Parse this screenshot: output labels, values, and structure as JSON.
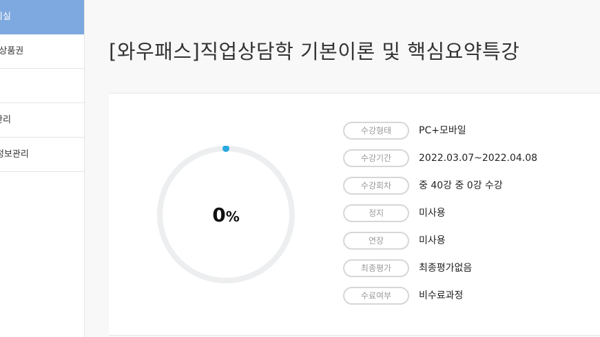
{
  "sidebar": {
    "items": [
      {
        "label": "의실",
        "active": true
      },
      {
        "label": "/상품권",
        "active": false
      },
      {
        "label": "",
        "active": false
      },
      {
        "label": "관리",
        "active": false
      },
      {
        "label": "정보관리",
        "active": false
      }
    ]
  },
  "course": {
    "title": "[와우패스]직업상담학 기본이론 및 핵심요약특강"
  },
  "progress": {
    "value": 0,
    "number": "0",
    "sign": "%"
  },
  "info": [
    {
      "label": "수강형태",
      "value": "PC+모바일"
    },
    {
      "label": "수강기간",
      "value": "2022.03.07~2022.04.08"
    },
    {
      "label": "수강회차",
      "value": "중 40강 중 0강 수강"
    },
    {
      "label": "정지",
      "value": "미사용"
    },
    {
      "label": "연장",
      "value": "미사용"
    },
    {
      "label": "최종평가",
      "value": "최종평가없음"
    },
    {
      "label": "수료여부",
      "value": "비수료과정"
    }
  ],
  "colors": {
    "sidebar_active": "#7ea8e0",
    "progress_track": "#eceeef",
    "progress_dot": "#2aa8e0"
  }
}
